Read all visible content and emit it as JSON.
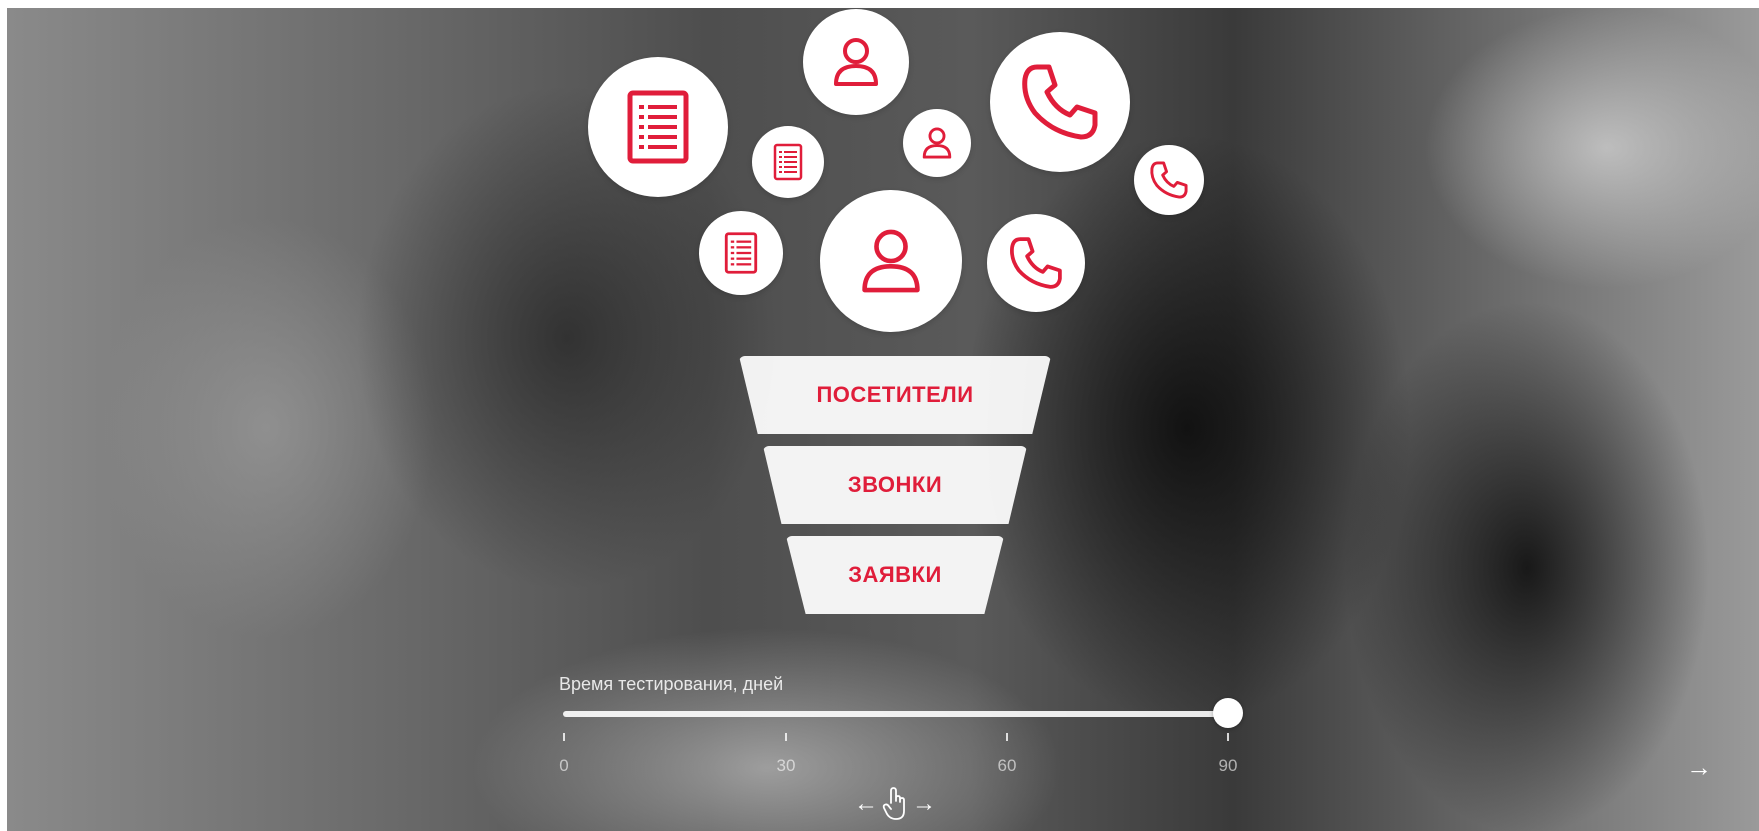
{
  "colors": {
    "accent": "#e01d3a",
    "bubble_bg": "#ffffff",
    "background_tone": "grayscale-blurred-office-photo"
  },
  "bubbles": [
    {
      "icon": "document-icon"
    },
    {
      "icon": "person-icon"
    },
    {
      "icon": "phone-icon"
    },
    {
      "icon": "document-icon"
    },
    {
      "icon": "person-icon"
    },
    {
      "icon": "phone-icon"
    },
    {
      "icon": "document-icon"
    },
    {
      "icon": "person-icon"
    },
    {
      "icon": "phone-icon"
    }
  ],
  "funnel": {
    "visitors": "ПОСЕТИТЕЛИ",
    "calls": "ЗВОНКИ",
    "requests": "ЗАЯВКИ"
  },
  "slider": {
    "label": "Время тестирования, дней",
    "min": 0,
    "max": 90,
    "value": 90,
    "ticks": [
      "0",
      "30",
      "60",
      "90"
    ]
  },
  "navigation": {
    "swipe_hint_left": "←",
    "swipe_hint_right": "→",
    "next_arrow": "→"
  }
}
